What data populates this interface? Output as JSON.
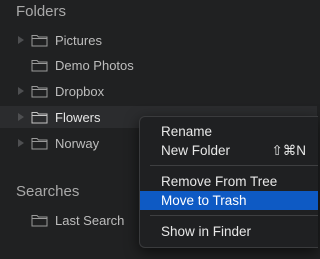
{
  "folders_section": {
    "title": "Folders",
    "items": [
      {
        "label": "Pictures",
        "expandable": true,
        "selected": false
      },
      {
        "label": "Demo Photos",
        "expandable": false,
        "selected": false
      },
      {
        "label": "Dropbox",
        "expandable": true,
        "selected": false
      },
      {
        "label": "Flowers",
        "expandable": true,
        "selected": true
      },
      {
        "label": "Norway",
        "expandable": true,
        "selected": false
      }
    ]
  },
  "searches_section": {
    "title": "Searches",
    "items": [
      {
        "label": "Last Search"
      }
    ]
  },
  "context_menu": {
    "rename": "Rename",
    "new_folder": "New Folder",
    "new_folder_shortcut": "⇧⌘N",
    "remove_from_tree": "Remove From Tree",
    "move_to_trash": "Move to Trash",
    "show_in_finder": "Show in Finder",
    "highlighted_item": "Move to Trash"
  },
  "colors": {
    "background": "#202122",
    "menu_highlight": "#0e5ac4",
    "selected_row": "#2b2c2e"
  }
}
